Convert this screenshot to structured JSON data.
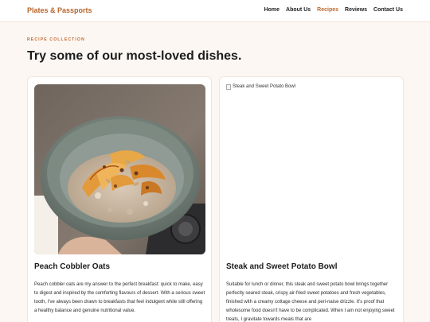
{
  "nav": {
    "brand": "Plates & Passports",
    "links": [
      "Home",
      "About Us",
      "Recipes",
      "Reviews",
      "Contact Us"
    ],
    "active_link": "Recipes"
  },
  "hero": {
    "eyebrow": "RECIPE COLLECTION",
    "headline": "Try some of our most-loved dishes."
  },
  "cards": [
    {
      "title": "Peach Cobbler Oats",
      "body": "Peach cobbler oats are my answer to the perfect breakfast: quick to make, easy to digest and inspired by the comforting flavours of dessert. With a serious sweet tooth, I've always been drawn to breakfasts that feel indulgent while still offering a healthy balance and genuine nutritional value."
    },
    {
      "title": "Steak and Sweet Potato Bowl",
      "image_alt": "Steak and Sweet Potato Bowl",
      "body": "Suitable for lunch or dinner, this steak and sweet potato bowl brings together perfectly seared steak, crispy air-fried sweet potatoes and fresh vegetables, finished with a creamy cottage cheese and peri-naise drizzle. It's proof that wholesome food doesn't have to be complicated. When I am not enjoying sweet treats, I gravitate towards meals that are"
    }
  ],
  "colors": {
    "accent": "#c0662a",
    "brand": "#b5652b",
    "page_background": "#fcf7f3"
  }
}
